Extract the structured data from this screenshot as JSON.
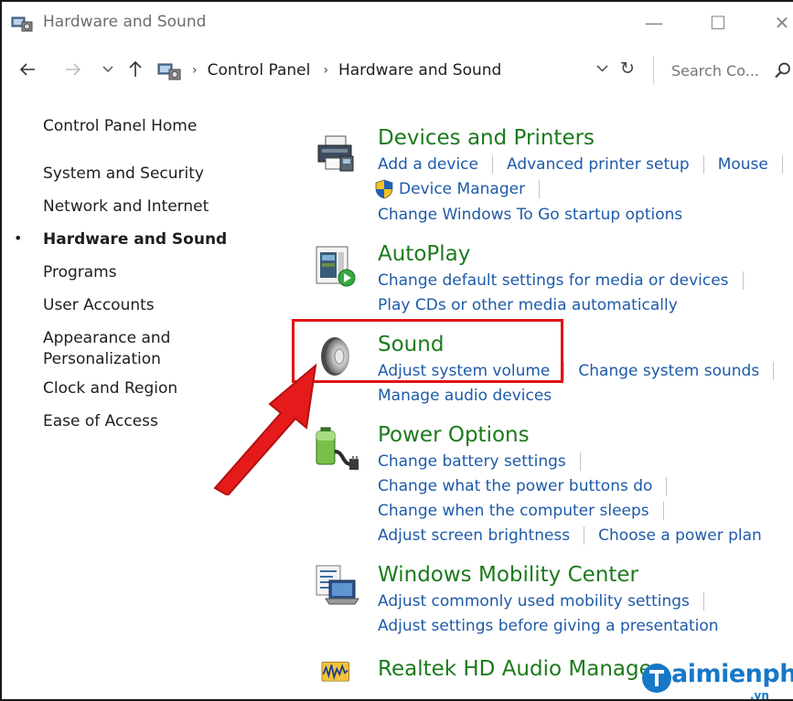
{
  "window": {
    "title": "Hardware and Sound",
    "minimize_glyph": "—",
    "maximize_glyph": "☐",
    "close_glyph": "✕"
  },
  "address_bar": {
    "crumbs": [
      "Control Panel",
      "Hardware and Sound"
    ],
    "search_placeholder": "Search Co..."
  },
  "sidebar": {
    "items": [
      {
        "label": "Control Panel Home"
      },
      {
        "label": "System and Security"
      },
      {
        "label": "Network and Internet"
      },
      {
        "label": "Hardware and Sound",
        "current": true
      },
      {
        "label": "Programs"
      },
      {
        "label": "User Accounts"
      },
      {
        "label": "Appearance and"
      },
      {
        "label": "Personalization"
      },
      {
        "label": "Clock and Region"
      },
      {
        "label": "Ease of Access"
      }
    ]
  },
  "categories": {
    "devices": {
      "title": "Devices and Printers",
      "links": [
        "Add a device",
        "Advanced printer setup",
        "Mouse",
        "Device Manager",
        "Change Windows To Go startup options"
      ]
    },
    "autoplay": {
      "title": "AutoPlay",
      "links": [
        "Change default settings for media or devices",
        "Play CDs or other media automatically"
      ]
    },
    "sound": {
      "title": "Sound",
      "links": [
        "Adjust system volume",
        "Change system sounds",
        "Manage audio devices"
      ]
    },
    "power": {
      "title": "Power Options",
      "links": [
        "Change battery settings",
        "Change what the power buttons do",
        "Change when the computer sleeps",
        "Adjust screen brightness",
        "Choose a power plan"
      ]
    },
    "mobility": {
      "title": "Windows Mobility Center",
      "links": [
        "Adjust commonly used mobility settings",
        "Adjust settings before giving a presentation"
      ]
    },
    "realtek": {
      "title": "Realtek HD Audio Manager"
    }
  },
  "watermark": {
    "brand": "aimienphi",
    "suffix": ".vn"
  },
  "colors": {
    "category_title": "#1c7a1c",
    "link": "#1e5aa8",
    "highlight": "#e01414",
    "watermark": "#1778c8"
  }
}
